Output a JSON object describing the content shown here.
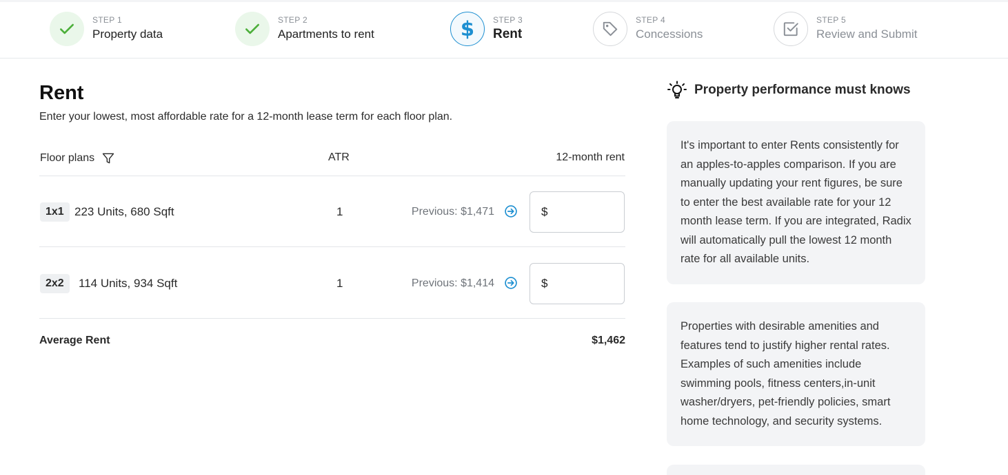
{
  "stepper": {
    "steps": [
      {
        "num": "STEP 1",
        "label": "Property data",
        "state": "done"
      },
      {
        "num": "STEP 2",
        "label": "Apartments to rent",
        "state": "done"
      },
      {
        "num": "STEP 3",
        "label": "Rent",
        "state": "active"
      },
      {
        "num": "STEP 4",
        "label": "Concessions",
        "state": "todo"
      },
      {
        "num": "STEP 5",
        "label": "Review and Submit",
        "state": "todo"
      }
    ]
  },
  "main": {
    "title": "Rent",
    "subtitle": "Enter your lowest, most affordable rate for a 12-month lease term for each floor plan.",
    "columns": {
      "floor_plans": "Floor plans",
      "atr": "ATR",
      "rent": "12-month rent"
    },
    "rows": [
      {
        "plan": "1x1",
        "desc": "223 Units, 680 Sqft",
        "atr": "1",
        "previous": "Previous: $1,471",
        "currency": "$",
        "value": ""
      },
      {
        "plan": "2x2",
        "desc": "114 Units, 934 Sqft",
        "atr": "1",
        "previous": "Previous: $1,414",
        "currency": "$",
        "value": ""
      }
    ],
    "average_label": "Average Rent",
    "average_value": "$1,462"
  },
  "sidebar": {
    "title": "Property performance must knows",
    "tips": [
      "It's important to enter Rents consistently for an apples-to-apples comparison. If you are manually updating your rent figures, be sure to enter the best available rate for your 12 month lease term. If you are integrated, Radix will automatically pull the lowest 12 month rate for all available units.",
      "Properties with desirable amenities and features tend to justify higher rental rates. Examples of such amenities include swimming pools, fitness centers,in-unit washer/dryers, pet-friendly policies, smart home technology, and security systems."
    ]
  },
  "colors": {
    "accent": "#1d8fd1",
    "success": "#4caf3a",
    "muted": "#8a8f96",
    "card_bg": "#f3f4f6"
  },
  "icons": {
    "step_done": "check-icon",
    "step_3": "dollar-icon",
    "step_4": "tag-icon",
    "step_5": "checkbox-icon",
    "filter": "filter-icon",
    "apply_previous": "arrow-right-circle-icon",
    "sidebar_head": "lightbulb-icon"
  }
}
